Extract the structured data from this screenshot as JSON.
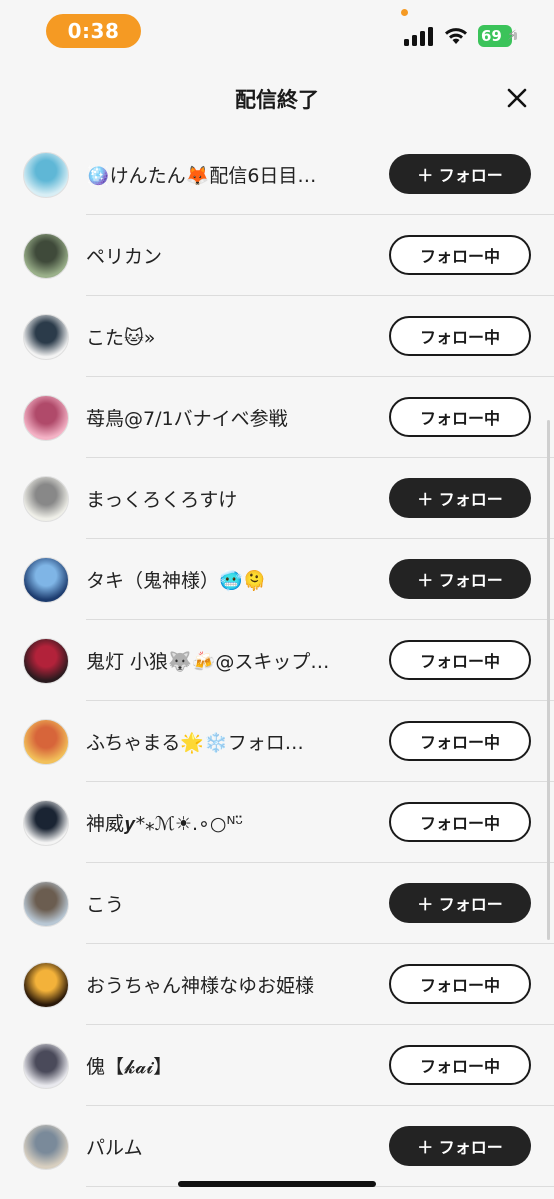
{
  "status_bar": {
    "time": "0:38",
    "battery": "69"
  },
  "header": {
    "title": "配信終了"
  },
  "rows": [
    {
      "name": "🪩けんたん🦊配信6日目…",
      "button": "＋ フォロー",
      "state": "follow",
      "avatar_colors": [
        "#d8eef5",
        "#5fb7d6"
      ]
    },
    {
      "name": "ペリカン",
      "button": "フォロー中",
      "state": "following",
      "avatar_colors": [
        "#9ab08a",
        "#3f4a3a"
      ]
    },
    {
      "name": "こた🐱»",
      "button": "フォロー中",
      "state": "following",
      "avatar_colors": [
        "#f3f3f3",
        "#2b3b4a"
      ]
    },
    {
      "name": "苺鳥@7/1バナイベ参戦",
      "button": "フォロー中",
      "state": "following",
      "avatar_colors": [
        "#f4b3c6",
        "#b04a6a"
      ]
    },
    {
      "name": "まっくろくろすけ",
      "button": "＋ フォロー",
      "state": "follow",
      "avatar_colors": [
        "#efefe8",
        "#888"
      ]
    },
    {
      "name": "タキ（鬼神様）🥶🫠",
      "button": "＋ フォロー",
      "state": "follow",
      "avatar_colors": [
        "#1c3b6e",
        "#7fb5e6"
      ]
    },
    {
      "name": "鬼灯 小狼🐺🍻@スキップ…",
      "button": "フォロー中",
      "state": "following",
      "avatar_colors": [
        "#2a1a1e",
        "#b2223a"
      ]
    },
    {
      "name": "ふちゃまる🌟❄️フォロ…",
      "button": "フォロー中",
      "state": "following",
      "avatar_colors": [
        "#f2c05a",
        "#d7653a"
      ]
    },
    {
      "name": "神威𝒚*⁎ℳ☀︎.∘○ᴺᵕ̈",
      "button": "フォロー中",
      "state": "following",
      "avatar_colors": [
        "#f4f4f4",
        "#1a2433"
      ]
    },
    {
      "name": "こう",
      "button": "＋ フォロー",
      "state": "follow",
      "avatar_colors": [
        "#b8c7d4",
        "#6b5d50"
      ]
    },
    {
      "name": "おうちゃん神様なゆお姫様",
      "button": "フォロー中",
      "state": "following",
      "avatar_colors": [
        "#2a1808",
        "#f3b23a"
      ]
    },
    {
      "name": "傀【𝓴𝓪𝓲】",
      "button": "フォロー中",
      "state": "following",
      "avatar_colors": [
        "#e9e9ee",
        "#4a4a5a"
      ]
    },
    {
      "name": "パルム",
      "button": "＋ フォロー",
      "state": "follow",
      "avatar_colors": [
        "#d8cfc0",
        "#7a8a9a"
      ]
    }
  ],
  "icons": {
    "close": "close-icon",
    "signal": "cellular-signal-icon",
    "wifi": "wifi-icon",
    "battery": "battery-icon"
  },
  "colors": {
    "accent": "#f59a23",
    "follow_bg": "#232323",
    "battery": "#3bc35a"
  }
}
